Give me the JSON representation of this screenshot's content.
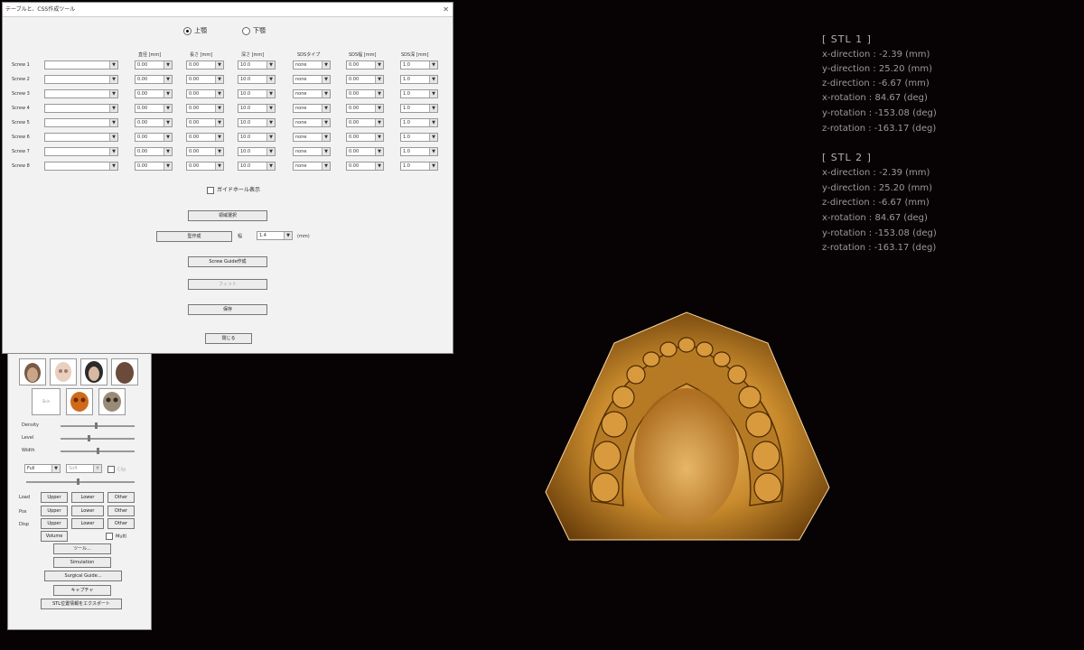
{
  "dialog": {
    "title": "テーブルと、CSS作成ツール",
    "radio_upper": "上顎",
    "radio_lower": "下顎",
    "columns": [
      "直径 [mm]",
      "長さ [mm]",
      "深さ [mm]",
      "SDSタイプ",
      "SDS幅 [mm]",
      "SDS深 [mm]"
    ],
    "rows": [
      {
        "label": "Screw 1",
        "v": [
          "0.00",
          "0.00",
          "10.0",
          "none",
          "0.00",
          "1.0"
        ]
      },
      {
        "label": "Screw 2",
        "v": [
          "0.00",
          "0.00",
          "10.0",
          "none",
          "0.00",
          "1.0"
        ]
      },
      {
        "label": "Screw 3",
        "v": [
          "0.00",
          "0.00",
          "10.0",
          "none",
          "0.00",
          "1.0"
        ]
      },
      {
        "label": "Screw 4",
        "v": [
          "0.00",
          "0.00",
          "10.0",
          "none",
          "0.00",
          "1.0"
        ]
      },
      {
        "label": "Screw 5",
        "v": [
          "0.00",
          "0.00",
          "10.0",
          "none",
          "0.00",
          "1.0"
        ]
      },
      {
        "label": "Screw 6",
        "v": [
          "0.00",
          "0.00",
          "10.0",
          "none",
          "0.00",
          "1.0"
        ]
      },
      {
        "label": "Screw 7",
        "v": [
          "0.00",
          "0.00",
          "10.0",
          "none",
          "0.00",
          "1.0"
        ]
      },
      {
        "label": "Screw 8",
        "v": [
          "0.00",
          "0.00",
          "10.0",
          "none",
          "0.00",
          "1.0"
        ]
      }
    ],
    "checkbox_label": "ガイドホール表示",
    "btn_select": "領域選択",
    "btn_shape": "型作成",
    "width_label": "幅",
    "width_value": "1.4",
    "width_unit": "(mm)",
    "btn_screw_guide": "Screw Guide作成",
    "btn_fit": "フィット",
    "btn_save": "保存",
    "btn_close": "閉じる"
  },
  "panel": {
    "face_labels": [
      "Skin",
      "Skull",
      "Face",
      "Hair"
    ],
    "slider_labels": [
      "Density",
      "Level",
      "Width"
    ],
    "dropdown_a": "Full",
    "dropdown_b": "Soft",
    "check_clip": "Clip",
    "row_load": {
      "label": "Load",
      "buttons": [
        "Upper",
        "Lower",
        "Other"
      ]
    },
    "row_pos": {
      "label": "Pos",
      "buttons": [
        "Upper",
        "Lower",
        "Other"
      ]
    },
    "row_disp": {
      "label": "Disp",
      "buttons": [
        "Upper",
        "Lower",
        "Other"
      ]
    },
    "btn_volume": "Volume",
    "check_multi": "Multi",
    "btn_tools": "ツール...",
    "btn_simulation": "Simulation",
    "btn_surgical": "Surgical Guide...",
    "btn_capture": "キャプチャ",
    "btn_stl_export": "STL位置情報をエクスポート"
  },
  "stl1": {
    "header": "[ STL 1 ]",
    "lines": [
      "x-direction : -2.39 (mm)",
      "y-direction : 25.20 (mm)",
      "z-direction : -6.67 (mm)",
      "x-rotation : 84.67 (deg)",
      "y-rotation : -153.08 (deg)",
      "z-rotation : -163.17 (deg)"
    ]
  },
  "stl2": {
    "header": "[ STL 2 ]",
    "lines": [
      "x-direction : -2.39 (mm)",
      "y-direction : 25.20 (mm)",
      "z-direction : -6.67 (mm)",
      "x-rotation : 84.67 (deg)",
      "y-rotation : -153.08 (deg)",
      "z-rotation : -163.17 (deg)"
    ]
  },
  "colors": {
    "background": "#070203",
    "model_gold": "#c88a2c",
    "readout": "#9a9a9a"
  }
}
